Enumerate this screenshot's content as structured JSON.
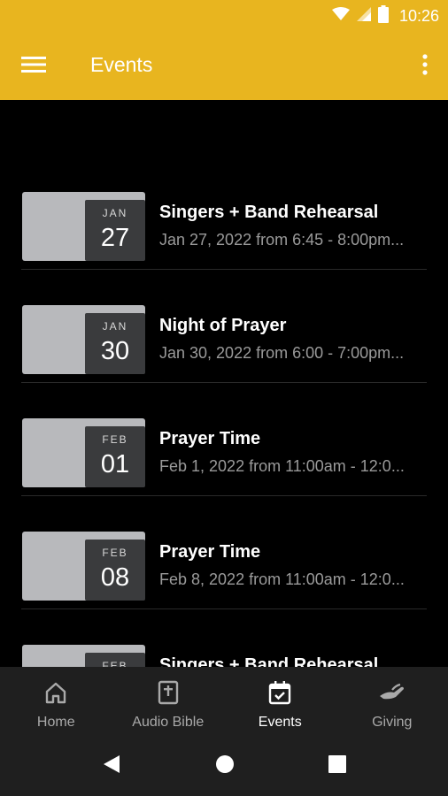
{
  "status": {
    "time": "10:26"
  },
  "header": {
    "title": "Events"
  },
  "events": [
    {
      "month": "JAN",
      "day": "27",
      "title": "Singers + Band Rehearsal",
      "subtitle": "Jan 27, 2022 from 6:45 - 8:00pm..."
    },
    {
      "month": "JAN",
      "day": "30",
      "title": "Night of Prayer",
      "subtitle": "Jan 30, 2022 from 6:00 - 7:00pm..."
    },
    {
      "month": "FEB",
      "day": "01",
      "title": "Prayer Time",
      "subtitle": "Feb 1, 2022 from 11:00am - 12:0..."
    },
    {
      "month": "FEB",
      "day": "08",
      "title": "Prayer Time",
      "subtitle": "Feb 8, 2022 from 11:00am - 12:0..."
    },
    {
      "month": "FEB",
      "day": "",
      "title": "Singers + Band Rehearsal",
      "subtitle": ""
    }
  ],
  "nav": {
    "items": [
      {
        "label": "Home",
        "icon": "home-icon"
      },
      {
        "label": "Audio Bible",
        "icon": "bible-icon"
      },
      {
        "label": "Events",
        "icon": "calendar-icon",
        "active": true
      },
      {
        "label": "Giving",
        "icon": "giving-hand-icon"
      }
    ]
  },
  "colors": {
    "accent": "#e8b51f",
    "background": "#000000",
    "navBackground": "#1f1f1f"
  }
}
